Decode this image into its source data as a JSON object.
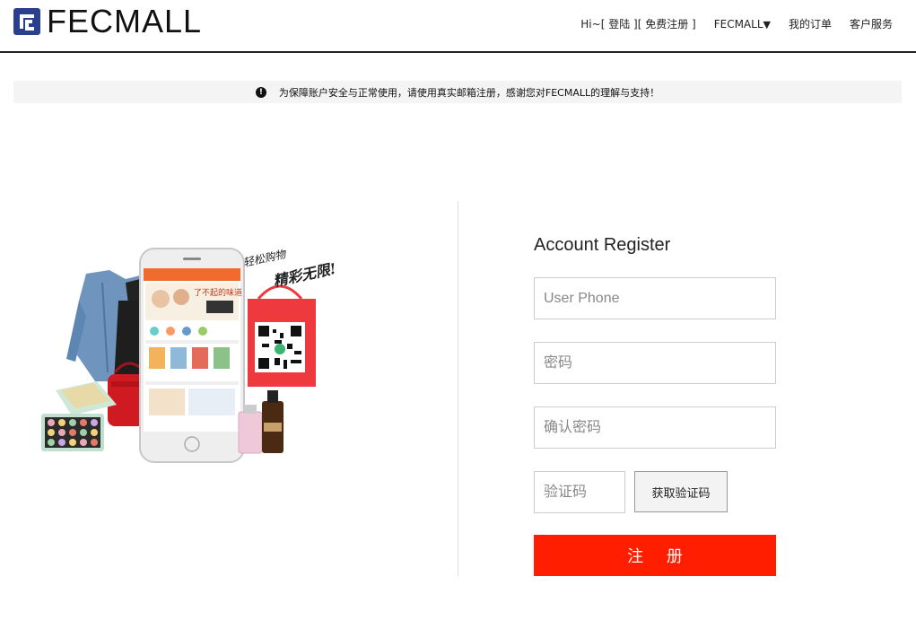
{
  "brand": {
    "logo_text": "FECMALL",
    "accent": "#ff1e00",
    "logo_color": "#2b3f8f"
  },
  "nav": {
    "greeting": "Hi~",
    "login": "[ 登陆 ]",
    "register": "[ 免费注册 ]",
    "site_menu": "FECMALL",
    "site_menu_caret": "▼",
    "orders": "我的订单",
    "service": "客户服务"
  },
  "notice": {
    "icon": "exclamation-icon",
    "text": "为保障账户安全与正常使用，请使用真实邮箱注册，感谢您对FECMALL的理解与支持！"
  },
  "promo": {
    "slogan_line1": "轻松购物",
    "slogan_line2": "精彩无限!",
    "phone_banner": "了不起的味道"
  },
  "form": {
    "title": "Account Register",
    "phone_placeholder": "User Phone",
    "password_placeholder": "密码",
    "confirm_placeholder": "确认密码",
    "code_placeholder": "验证码",
    "get_code_label": "获取验证码",
    "submit_label": "注 册"
  }
}
